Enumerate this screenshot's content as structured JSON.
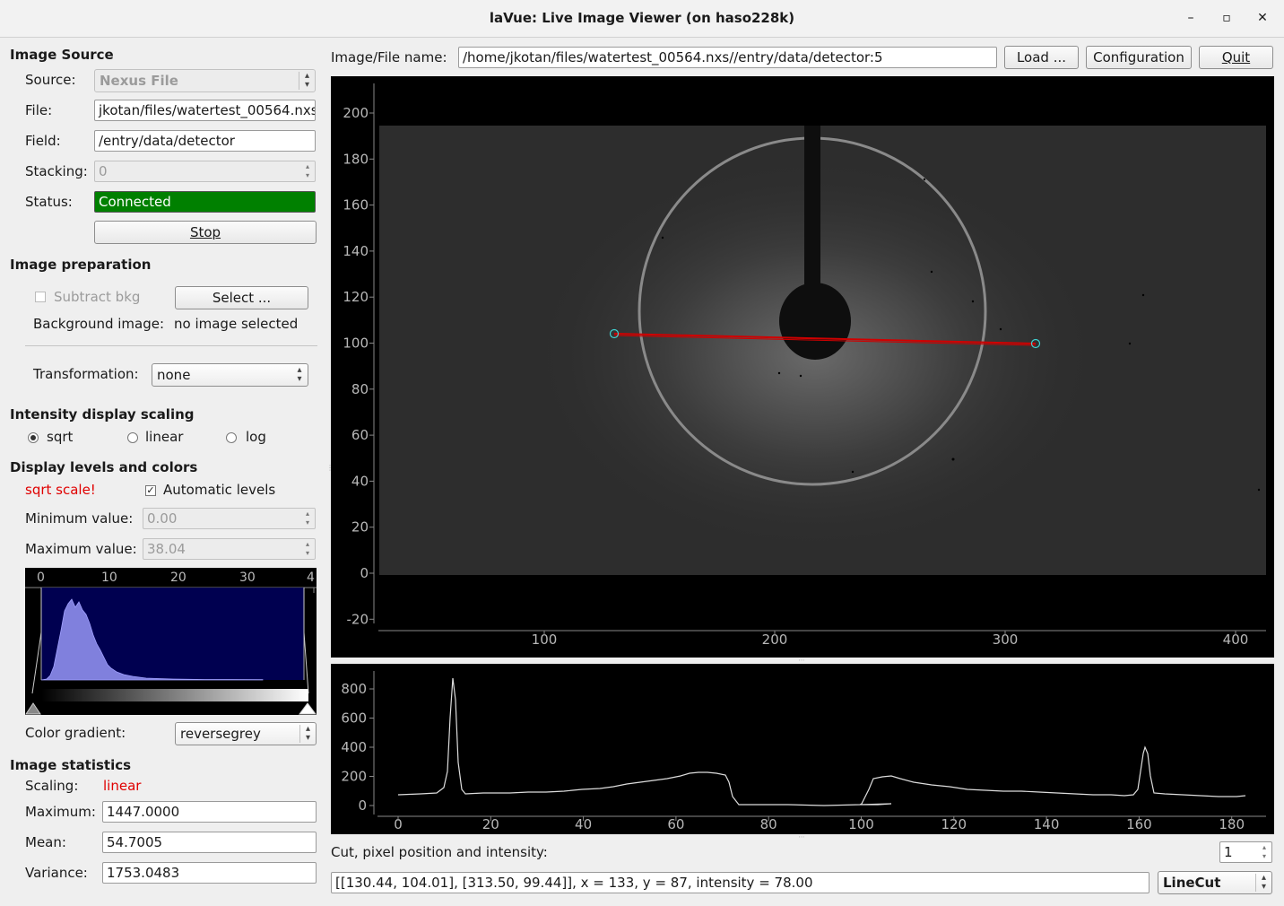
{
  "window": {
    "title": "laVue: Live Image Viewer (on haso228k)",
    "min": "–",
    "max": "▫",
    "close": "✕"
  },
  "image_source": {
    "heading": "Image Source",
    "source_label": "Source:",
    "source_value": "Nexus File",
    "file_label": "File:",
    "file_value": "jkotan/files/watertest_00564.nxs",
    "field_label": "Field:",
    "field_value": "/entry/data/detector",
    "stacking_label": "Stacking:",
    "stacking_value": "0",
    "status_label": "Status:",
    "status_value": "Connected",
    "stop_button": "Stop"
  },
  "image_preparation": {
    "heading": "Image preparation",
    "subtract_bkg": "Subtract bkg",
    "select_button": "Select ...",
    "bg_image_label": "Background image:",
    "bg_image_value": "no image selected",
    "transformation_label": "Transformation:",
    "transformation_value": "none"
  },
  "intensity_scaling": {
    "heading": "Intensity display scaling",
    "options": [
      "sqrt",
      "linear",
      "log"
    ],
    "selected": "sqrt"
  },
  "levels": {
    "heading": "Display levels and colors",
    "warning": "sqrt scale!",
    "auto_levels": "Automatic levels",
    "min_label": "Minimum value:",
    "min_value": "0.00",
    "max_label": "Maximum value:",
    "max_value": "38.04",
    "histogram_ticks": [
      "0",
      "10",
      "20",
      "30",
      "4"
    ],
    "gradient_label": "Color gradient:",
    "gradient_value": "reversegrey"
  },
  "statistics": {
    "heading": "Image statistics",
    "scaling_label": "Scaling:",
    "scaling_value": "linear",
    "maximum_label": "Maximum:",
    "maximum_value": "1447.0000",
    "mean_label": "Mean:",
    "mean_value": "54.7005",
    "variance_label": "Variance:",
    "variance_value": "1753.0483"
  },
  "top": {
    "filename_label": "Image/File name:",
    "filename_value": "/home/jkotan/files/watertest_00564.nxs//entry/data/detector:5",
    "load_button": "Load ...",
    "config_button": "Configuration",
    "quit_button": "Quit"
  },
  "image_plot": {
    "y_ticks": [
      "200",
      "180",
      "160",
      "140",
      "120",
      "100",
      "80",
      "60",
      "40",
      "20",
      "0",
      "-20"
    ],
    "x_ticks": [
      "100",
      "200",
      "300",
      "400"
    ],
    "cut_line": {
      "start": [
        130.44,
        104.01
      ],
      "end": [
        313.5,
        99.44
      ]
    }
  },
  "cut_plot": {
    "y_ticks": [
      "800",
      "600",
      "400",
      "200",
      "0"
    ],
    "x_ticks": [
      "0",
      "20",
      "40",
      "60",
      "80",
      "100",
      "120",
      "140",
      "160",
      "180"
    ]
  },
  "bottom": {
    "cut_label": "Cut, pixel position and intensity:",
    "cut_spin": "1",
    "info": "[[130.44, 104.01], [313.50, 99.44]], x = 133, y = 87, intensity = 78.00",
    "mode": "LineCut"
  }
}
